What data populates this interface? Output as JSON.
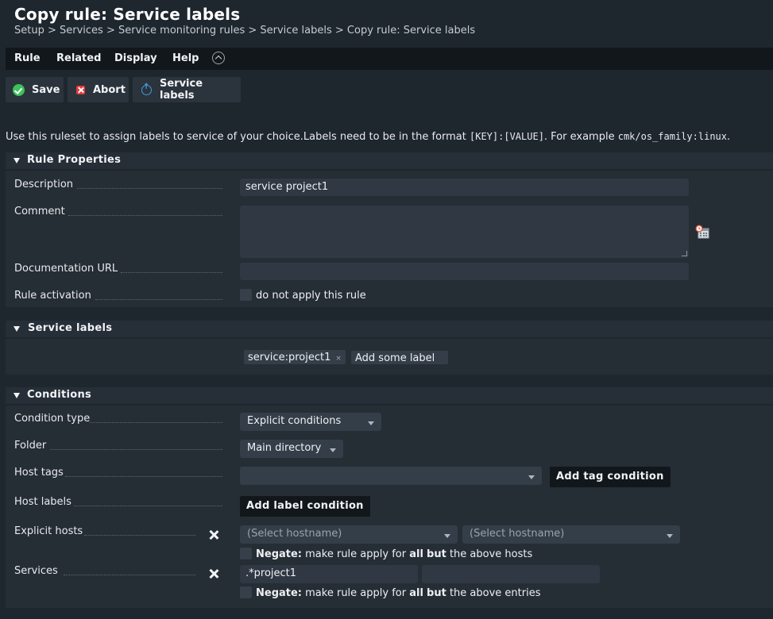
{
  "header": {
    "title": "Copy rule: Service labels",
    "breadcrumb": "Setup > Services > Service monitoring rules > Service labels > Copy rule: Service labels"
  },
  "menu": {
    "items": [
      "Rule",
      "Related",
      "Display",
      "Help"
    ]
  },
  "toolbar": {
    "save_label": "Save",
    "abort_label": "Abort",
    "service_labels_label": "Service labels"
  },
  "intro": {
    "text_before": "Use this ruleset to assign labels to service of your choice.Labels need to be in the format ",
    "format_code": "[KEY]:[VALUE]",
    "text_middle": ". For example ",
    "example_code": "cmk/os_family:linux",
    "text_after": "."
  },
  "rule_properties": {
    "heading": "Rule Properties",
    "description_label": "Description",
    "description_value": "service project1",
    "comment_label": "Comment",
    "comment_value": "",
    "doc_url_label": "Documentation URL",
    "doc_url_value": "",
    "activation_label": "Rule activation",
    "activation_checkbox_label": "do not apply this rule"
  },
  "service_labels": {
    "heading": "Service labels",
    "tag_value": "service:project1",
    "tag_remove": "×",
    "add_placeholder": "Add some label"
  },
  "conditions": {
    "heading": "Conditions",
    "condition_type_label": "Condition type",
    "condition_type_value": "Explicit conditions",
    "folder_label": "Folder",
    "folder_value": "Main directory",
    "host_tags_label": "Host tags",
    "host_tags_value": "",
    "add_tag_condition": "Add tag condition",
    "host_labels_label": "Host labels",
    "add_label_condition": "Add label condition",
    "explicit_hosts_label": "Explicit hosts",
    "hostname_placeholder_1": "(Select hostname)",
    "hostname_placeholder_2": "(Select hostname)",
    "negate_bold": "Negate:",
    "negate_hosts_1": " make rule apply for ",
    "negate_all": "all",
    "negate_but": "but",
    "negate_hosts_2": " the above hosts",
    "services_label": "Services",
    "service_value_1": ".*project1",
    "service_value_2": "",
    "negate_entries_2": " the above entries"
  }
}
